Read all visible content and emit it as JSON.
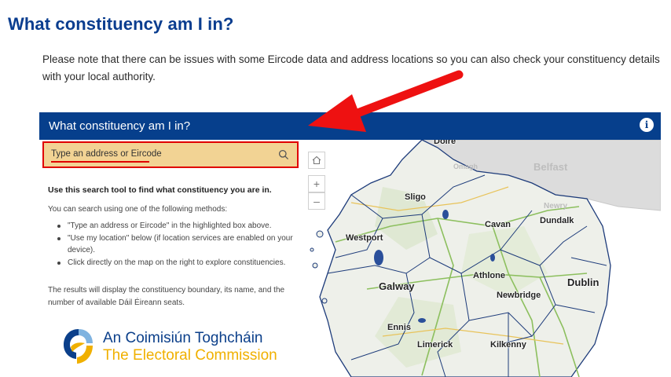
{
  "page": {
    "title": "What constituency am I in?",
    "note": "Please note that there can be issues with some Eircode data and address locations so you can also check your constituency details with your local authority."
  },
  "app": {
    "header_title": "What constituency am I in?",
    "info_icon": "i",
    "search_placeholder": "Type an address or Eircode",
    "intro": "Use this search tool to find what constituency you are in.",
    "methods_intro": "You can search using one of the following methods:",
    "methods": [
      "\"Type an address or Eircode\" in the highlighted box above.",
      "\"Use my location\" below (if location services are enabled on your device).",
      "Click directly on the map on the right to explore constituencies."
    ],
    "results": "The results will display the constituency boundary, its name, and the number of available Dáil Éireann seats.",
    "logo_irish": "An Coimisiún Toghcháin",
    "logo_english": "The Electoral Commission"
  },
  "map": {
    "zoom_in": "+",
    "zoom_out": "–",
    "labels": {
      "derry": "Doire",
      "omagh": "Omagh",
      "belfast": "Belfast",
      "newry": "Newry",
      "sligo": "Sligo",
      "cavan": "Cavan",
      "dundalk": "Dundalk",
      "westport": "Westport",
      "athlone": "Athlone",
      "dublin": "Dublin",
      "galway": "Galway",
      "newbridge": "Newbridge",
      "ennis": "Ennis",
      "limerick": "Limerick",
      "kilkenny": "Kilkenny"
    }
  },
  "colors": {
    "title_blue": "#0a3d8f",
    "header_blue": "#063f8c",
    "search_highlight": "#f2d394",
    "annotation_red": "#e00000",
    "logo_yellow": "#f0b000"
  }
}
